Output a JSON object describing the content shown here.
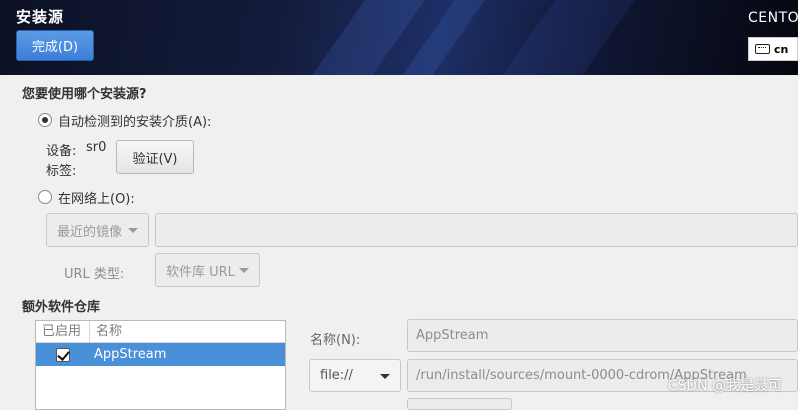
{
  "header": {
    "title": "安装源",
    "done_label": "完成(D)",
    "product": "CENTOS",
    "keyboard_layout": "cn"
  },
  "source": {
    "question": "您要使用哪个安装源?",
    "auto_label": "自动检测到的安装介质(A):",
    "device_label": "设备:",
    "device_value": "sr0",
    "tag_label": "标签:",
    "verify_label": "验证(V)",
    "network_label": "在网络上(O):",
    "mirror_combo": "最近的镜像",
    "url_type_label": "URL 类型:",
    "url_type_combo": "软件库 URL"
  },
  "repos": {
    "heading": "额外软件仓库",
    "col_enabled": "已启用",
    "col_name": "名称",
    "rows": [
      {
        "name": "AppStream",
        "enabled": true
      }
    ],
    "name_label": "名称(N):",
    "name_value": "AppStream",
    "protocol": "file://",
    "url_value": "/run/install/sources/mount-0000-cdrom/AppStream"
  },
  "watermark": "CSDN @我是聂可"
}
